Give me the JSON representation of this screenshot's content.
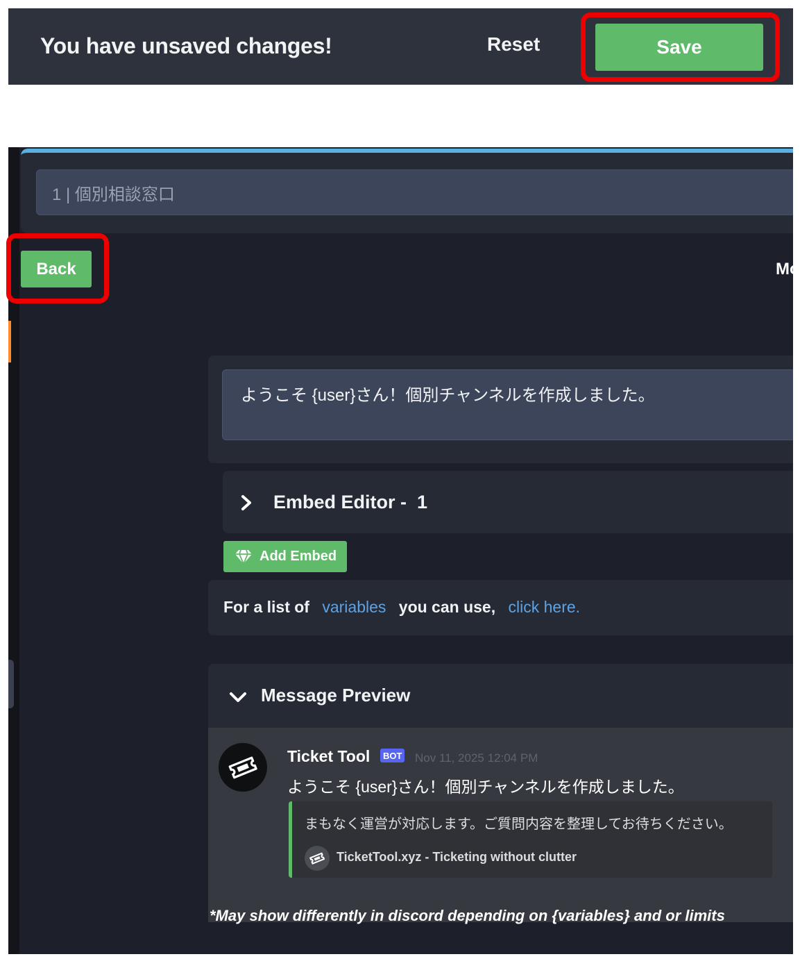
{
  "unsaved_bar": {
    "message": "You have unsaved changes!",
    "reset_label": "Reset",
    "save_label": "Save"
  },
  "panel": {
    "title_value": "1 | 個別相談窓口",
    "back_label": "Back",
    "cut_off_text": "Mo",
    "message_content": "ようこそ {user}さん！個別チャンネルを作成しました。",
    "embed_editor_title": "Embed Editor -  1",
    "add_embed_label": "Add Embed",
    "variables_text": {
      "prefix": "For a list of",
      "variables_link": "variables",
      "middle": "you can use,",
      "click_link": "click here."
    }
  },
  "preview": {
    "title": "Message Preview",
    "bot_name": "Ticket Tool",
    "bot_badge": "BOT",
    "timestamp": "Nov 11, 2025 12:04 PM",
    "message": "ようこそ {user}さん！個別チャンネルを作成しました。",
    "embed_description": "まもなく運営が対応します。ご質問内容を整理してお待ちください。",
    "embed_footer": "TicketTool.xyz - Ticketing without clutter",
    "disclaimer": "*May show differently in discord depending on {variables} and or limits"
  },
  "colors": {
    "accent_green": "#5fba6a",
    "highlight_red": "#ee0000",
    "link_blue": "#5ca3e6",
    "card_bg": "#262a35",
    "discord_bg": "#36393f"
  },
  "icons": [
    "chevron-right-icon",
    "chevron-down-icon",
    "gem-icon",
    "ticket-icon"
  ]
}
